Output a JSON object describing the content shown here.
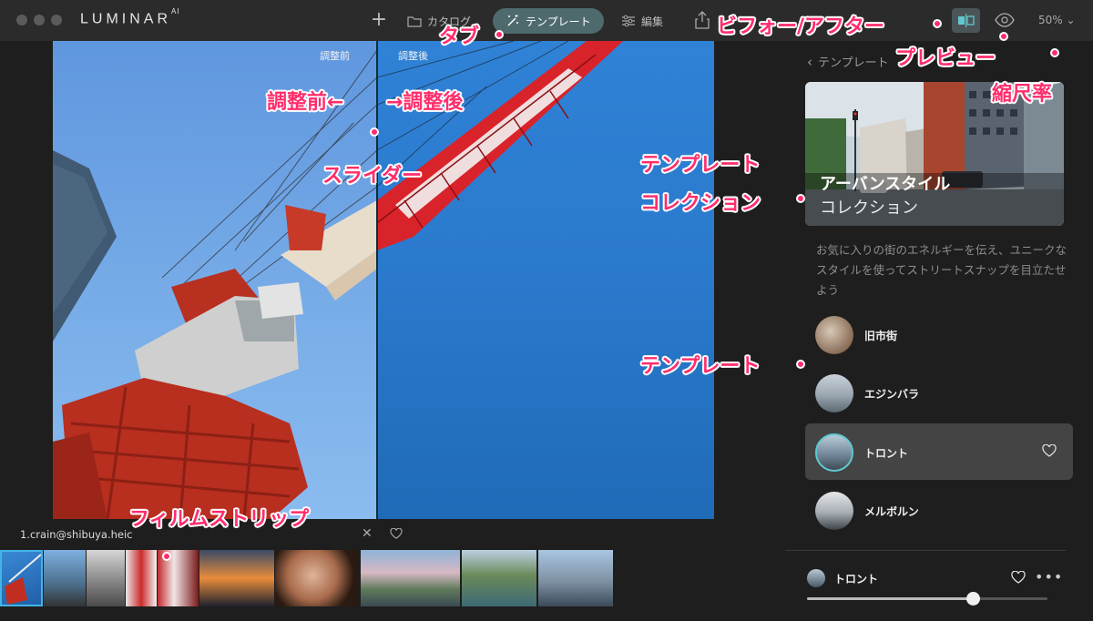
{
  "app": {
    "logo": "LUMINAR",
    "logo_sup": "AI"
  },
  "toolbar": {
    "tabs": [
      {
        "label": "カタログ",
        "icon": "folder-icon"
      },
      {
        "label": "テンプレート",
        "icon": "magic-wand-icon",
        "active": true
      },
      {
        "label": "編集",
        "icon": "sliders-icon"
      }
    ],
    "zoom": "50%",
    "accent_color": "#4f6a6d"
  },
  "canvas": {
    "before_label": "調整前",
    "after_label": "調整後"
  },
  "panel": {
    "back_label": "テンプレート",
    "collection": {
      "title": "アーバンスタイル",
      "subtitle": "コレクション"
    },
    "description": "お気に入りの街のエネルギーを伝え、ユニークなスタイルを使ってストリートスナップを目立たせよう",
    "templates": [
      {
        "name": "旧市街",
        "selected": false
      },
      {
        "name": "エジンバラ",
        "selected": false
      },
      {
        "name": "トロント",
        "selected": true
      },
      {
        "name": "メルボルン",
        "selected": false
      }
    ],
    "current": {
      "name": "トロント",
      "amount": 0.69
    }
  },
  "filmstrip": {
    "file_name": "1.crain@shibuya.heic",
    "count": 9,
    "selected_index": 0
  },
  "annotations": {
    "tab": "タブ",
    "before_after": "ビフォー/アフター",
    "preview": "プレビュー",
    "zoom": "縮尺率",
    "before": "調整前←",
    "after": "→調整後",
    "slider": "スライダー",
    "collection_line1": "テンプレート",
    "collection_line2": "コレクション",
    "template": "テンプレート",
    "filmstrip": "フィルムストリップ"
  }
}
